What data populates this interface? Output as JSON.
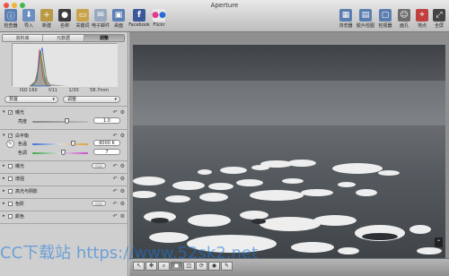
{
  "window": {
    "title": "Aperture"
  },
  "toolbar_left": [
    {
      "label": "检查器",
      "icon": "inspector-icon",
      "color": "#5b7fb5"
    },
    {
      "label": "导入",
      "icon": "import-icon",
      "color": "#6d8fbf"
    },
    {
      "label": "新建",
      "icon": "new-icon",
      "color": "#b99a44"
    },
    {
      "label": "名称",
      "icon": "name-icon",
      "color": "#3c3c3c"
    },
    {
      "label": "关键词",
      "icon": "keyword-icon",
      "color": "#c8a34a"
    },
    {
      "label": "电子邮件",
      "icon": "email-icon",
      "color": "#9aa9bd"
    },
    {
      "label": "桌面",
      "icon": "desktop-icon",
      "color": "#5d80b5"
    },
    {
      "label": "Facebook",
      "icon": "facebook-icon",
      "color": "#3b5998"
    },
    {
      "label": "Flickr",
      "icon": "flickr-icon",
      "color": "#e9e9e9"
    }
  ],
  "toolbar_right": [
    {
      "label": "浏览器",
      "icon": "browser-icon",
      "color": "#5c7eaf"
    },
    {
      "label": "胶片检图",
      "icon": "filmstrip-icon",
      "color": "#5c7eaf"
    },
    {
      "label": "检视器",
      "icon": "viewer-icon",
      "color": "#5c7eaf"
    },
    {
      "label": "面孔",
      "icon": "faces-icon",
      "color": "#6d6d6d"
    },
    {
      "label": "地点",
      "icon": "places-icon",
      "color": "#c04040"
    },
    {
      "label": "全屏",
      "icon": "fullscreen-icon",
      "color": "#444"
    }
  ],
  "inspector": {
    "tabs": [
      "资料库",
      "元数据",
      "调整"
    ],
    "active_tab": 2,
    "info": {
      "iso": "ISO 160",
      "aperture": "f/11",
      "shutter": "1/30",
      "focal": "58.7mm"
    },
    "preset_select": "预置",
    "adjust_select": "调整",
    "sections": {
      "exposure": {
        "name": "曝光",
        "rows": [
          {
            "label": "亮度",
            "value": "1.0",
            "level": 0.62
          }
        ]
      },
      "white_balance": {
        "name": "白平衡",
        "rows": [
          {
            "label": "色温",
            "value": "8000 K",
            "level": 0.72
          },
          {
            "label": "色调",
            "value": "7",
            "level": 0.55
          }
        ]
      },
      "collapsed": [
        {
          "name": "曝光",
          "auto": "自动"
        },
        {
          "name": "增强",
          "auto": ""
        },
        {
          "name": "高光与阴影",
          "auto": ""
        },
        {
          "name": "色阶",
          "auto": "自动"
        },
        {
          "name": "颜色",
          "auto": ""
        }
      ]
    }
  },
  "bottom_tools": [
    "↖",
    "✥",
    "⌕",
    "◼",
    "◫",
    "⟳",
    "◉",
    "✎"
  ],
  "watermark": "CC下载站  https://www.52sk2.net"
}
